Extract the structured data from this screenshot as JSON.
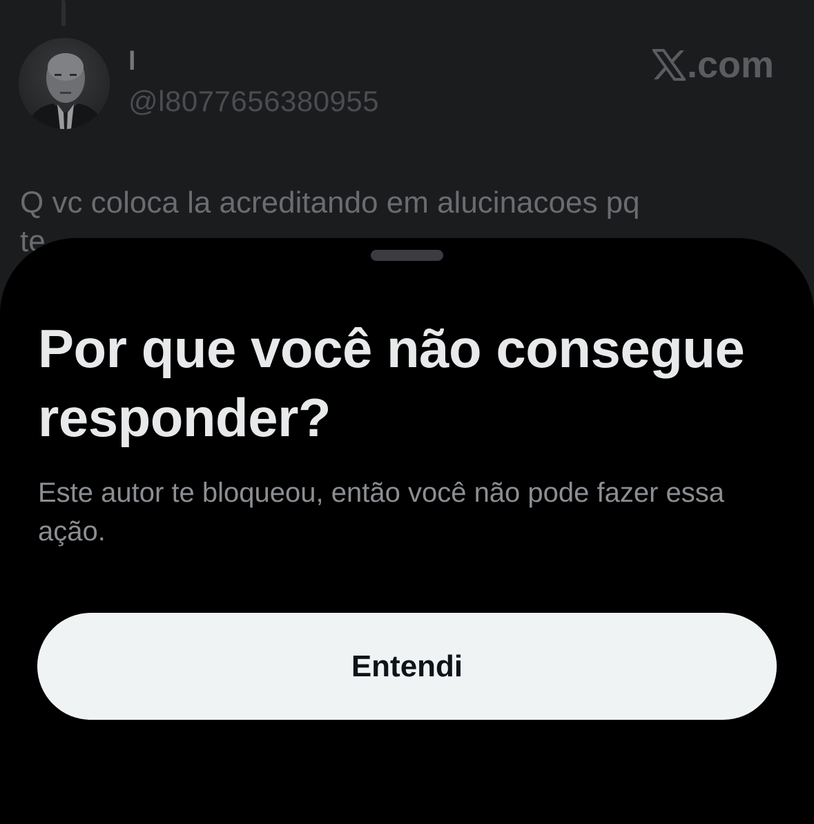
{
  "background_post": {
    "display_name": "l",
    "handle": "@l8077656380955",
    "watermark": {
      "icon": "x-logo-icon",
      "text": ".com"
    },
    "text_line_1": "Q vc coloca la acreditando em alucinacoes pq",
    "text_line_2": "te"
  },
  "sheet": {
    "title": "Por que você não consegue responder?",
    "message": "Este autor te bloqueou, então você não pode fazer essa ação.",
    "button_label": "Entendi"
  },
  "colors": {
    "sheet_background": "#000000",
    "backdrop": "#1b1c1e",
    "title_text": "#e7e9ea",
    "message_text": "#8b8e92",
    "button_background": "#eff3f4",
    "button_text": "#0f1419"
  }
}
